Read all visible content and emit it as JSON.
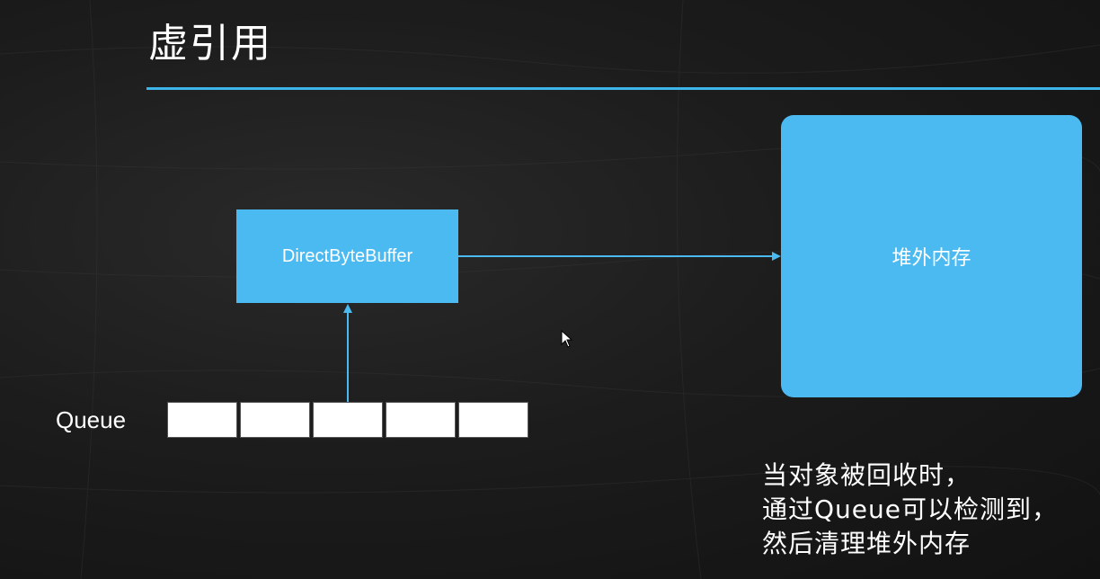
{
  "slide": {
    "title": "虚引用",
    "accent_color": "#3db4ea",
    "box_color": "#4bbaf0"
  },
  "diagram": {
    "direct_byte_buffer_label": "DirectByteBuffer",
    "off_heap_label": "堆外内存",
    "queue_label": "Queue",
    "queue_cells": 5
  },
  "note": {
    "lines": [
      "当对象被回收时，",
      "通过Queue可以检测到，",
      "然后清理堆外内存"
    ]
  }
}
